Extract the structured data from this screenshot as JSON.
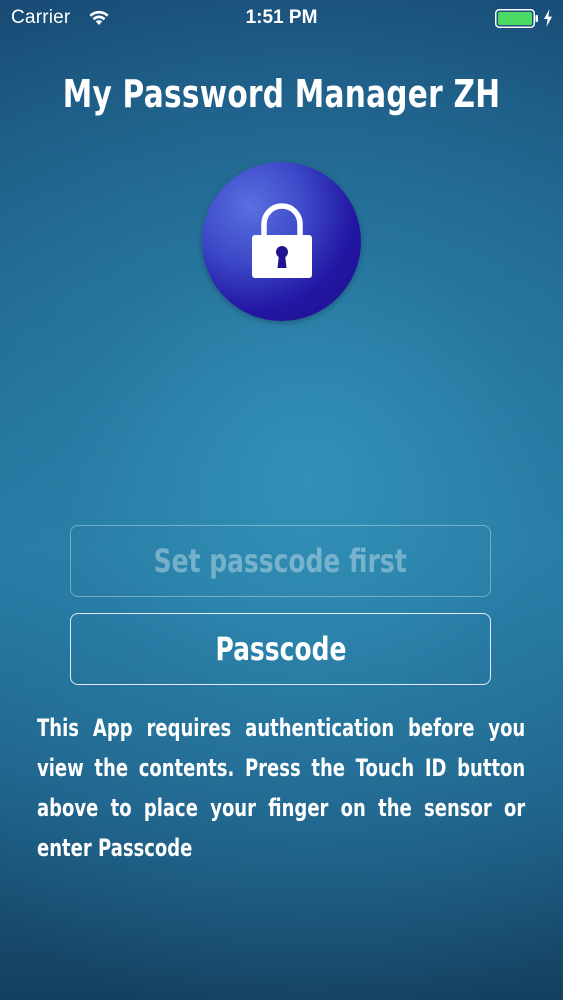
{
  "status_bar": {
    "carrier": "Carrier",
    "time": "1:51 PM",
    "battery_color": "#4cd964"
  },
  "title": "My Password Manager ZH",
  "lock_button": {
    "icon": "lock-icon",
    "gradient_start": "#5a6fe0",
    "gradient_end": "#1c0f8c"
  },
  "buttons": {
    "set_passcode_label": "Set passcode first",
    "passcode_label": "Passcode"
  },
  "description": {
    "line1": "This App requires authentication before you",
    "line2": "view the contents. Press the Touch ID button",
    "line3": "above to place your finger on the sensor or",
    "line4": "enter Passcode"
  }
}
